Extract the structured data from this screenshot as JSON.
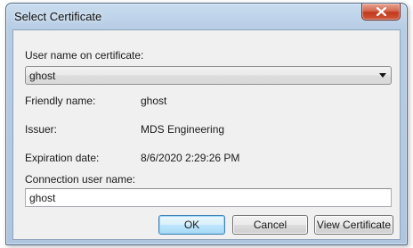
{
  "window": {
    "title": "Select Certificate"
  },
  "form": {
    "user_name_label": "User name on certificate:",
    "user_name_selected": "ghost",
    "friendly_name_label": "Friendly name:",
    "friendly_name_value": "ghost",
    "issuer_label": "Issuer:",
    "issuer_value": "MDS Engineering",
    "expiration_label": "Expiration date:",
    "expiration_value": "8/6/2020 2:29:26 PM",
    "connection_user_label": "Connection user name:",
    "connection_user_value": "ghost"
  },
  "buttons": {
    "ok": "OK",
    "cancel": "Cancel",
    "view_certificate": "View Certificate"
  },
  "icons": {
    "close": "close-icon",
    "dropdown": "chevron-down-icon"
  },
  "colors": {
    "title_bar": "#b7cde5",
    "close_button": "#c2391c",
    "dialog_body": "#f0f0f0",
    "default_button_border": "#3c7fb1"
  }
}
